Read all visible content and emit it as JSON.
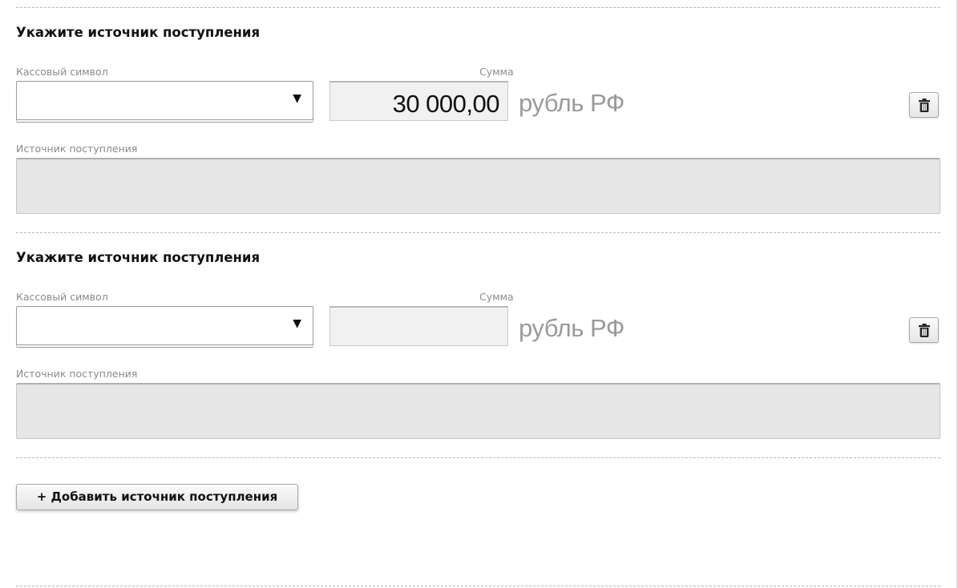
{
  "sections": [
    {
      "title": "Укажите источник поступления",
      "cash_symbol_label": "Кассовый символ",
      "cash_symbol_value": "",
      "amount_label": "Сумма",
      "amount_value": "30 000,00",
      "currency": "рубль РФ",
      "source_label": "Источник поступления",
      "source_value": ""
    },
    {
      "title": "Укажите источник поступления",
      "cash_symbol_label": "Кассовый символ",
      "cash_symbol_value": "",
      "amount_label": "Сумма",
      "amount_value": "",
      "currency": "рубль РФ",
      "source_label": "Источник поступления",
      "source_value": ""
    }
  ],
  "select_arrow": "▼",
  "add_source_label": "+ Добавить источник поступления",
  "icons": {
    "delete": "trash-icon",
    "dropdown": "triangle-down"
  },
  "colors": {
    "label": "#8a8a8a",
    "disabled_fill": "#e6e6e6",
    "currency": "#9a9a9a"
  }
}
